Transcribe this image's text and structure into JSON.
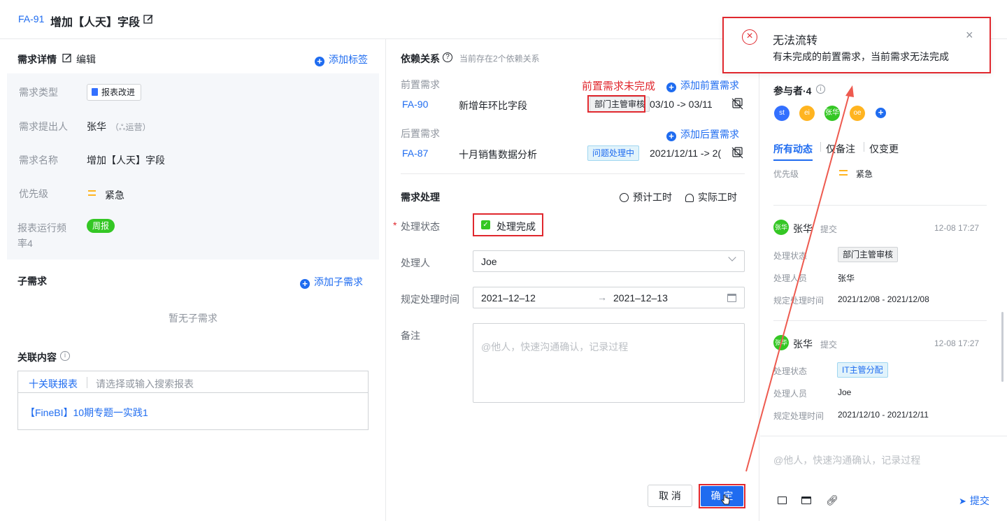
{
  "header": {
    "issue_id": "FA-91",
    "title": "增加【人天】字段"
  },
  "detail": {
    "title": "需求详情",
    "edit_label": "编辑",
    "add_tag_label": "添加标签",
    "fields": [
      {
        "label": "需求类型",
        "value": "报表改进"
      },
      {
        "label": "需求提出人",
        "value": "张华",
        "dept": "运营"
      },
      {
        "label": "需求名称",
        "value": "增加【人天】字段"
      },
      {
        "label": "优先级",
        "value": "紧急"
      },
      {
        "label": "报表运行频率4",
        "value": "周报"
      }
    ],
    "child_title": "子需求",
    "add_child_label": "添加子需求",
    "no_child_text": "暂无子需求",
    "related_title": "关联内容",
    "add_related_label": "十关联报表",
    "related_placeholder": "请选择或输入搜索报表",
    "related_item": "【FineBI】10期专题一实践1"
  },
  "dependency": {
    "title": "依赖关系",
    "count_text": "当前存在2个依赖关系",
    "pre_label": "前置需求",
    "pre_warning": "前置需求未完成",
    "add_pre_label": "添加前置需求",
    "pre_items": [
      {
        "id": "FA-90",
        "name": "新增年环比字段",
        "status": "部门主管审核",
        "date": "03/10 -> 03/11"
      }
    ],
    "post_label": "后置需求",
    "add_post_label": "添加后置需求",
    "post_items": [
      {
        "id": "FA-87",
        "name": "十月销售数据分析",
        "status": "问题处理中",
        "date": "2021/12/11 -> 2("
      }
    ]
  },
  "process": {
    "title": "需求处理",
    "estimate_label": "预计工时",
    "actual_label": "实际工时",
    "status_label": "处理状态",
    "status_value": "处理完成",
    "handler_label": "处理人",
    "handler_value": "Joe",
    "time_label": "规定处理时间",
    "time_start": "2021–12–12",
    "time_end": "2021–12–13",
    "note_label": "备注",
    "note_placeholder": "@他人，快速沟通确认，记录过程",
    "cancel_label": "取 消",
    "confirm_label": "确 定"
  },
  "activity": {
    "participants_label": "参与者·4",
    "participants": [
      {
        "name": "st",
        "color": "#3370ff"
      },
      {
        "name": "ei",
        "color": "#ffb420"
      },
      {
        "name": "张华",
        "color": "#34c724"
      },
      {
        "name": "oe",
        "color": "#ffb420"
      }
    ],
    "tabs": [
      "所有动态",
      "仅备注",
      "仅变更"
    ],
    "priority_row": {
      "label": "优先级",
      "value": "紧急"
    },
    "entries": [
      {
        "user": "张华",
        "avatar": "张华",
        "action": "提交",
        "time": "12-08 17:27",
        "status_label": "处理状态",
        "status": "部门主管审核",
        "handler_label": "处理人员",
        "handler": "张华",
        "time_label": "规定处理时间",
        "range": "2021/12/08 - 2021/12/08"
      },
      {
        "user": "张华",
        "avatar": "张华",
        "action": "提交",
        "time": "12-08 17:27",
        "status_label": "处理状态",
        "status": "IT主管分配",
        "handler_label": "处理人员",
        "handler": "Joe",
        "time_label": "规定处理时间",
        "range": "2021/12/10 - 2021/12/11"
      }
    ],
    "comment_placeholder": "@他人，快速沟通确认，记录过程",
    "submit_label": "提交"
  },
  "toast": {
    "title": "无法流转",
    "message": "有未完成的前置需求，当前需求无法完成"
  },
  "colors": {
    "accent": "#1f6cf0",
    "danger": "#e0282e",
    "success": "#34c724"
  }
}
